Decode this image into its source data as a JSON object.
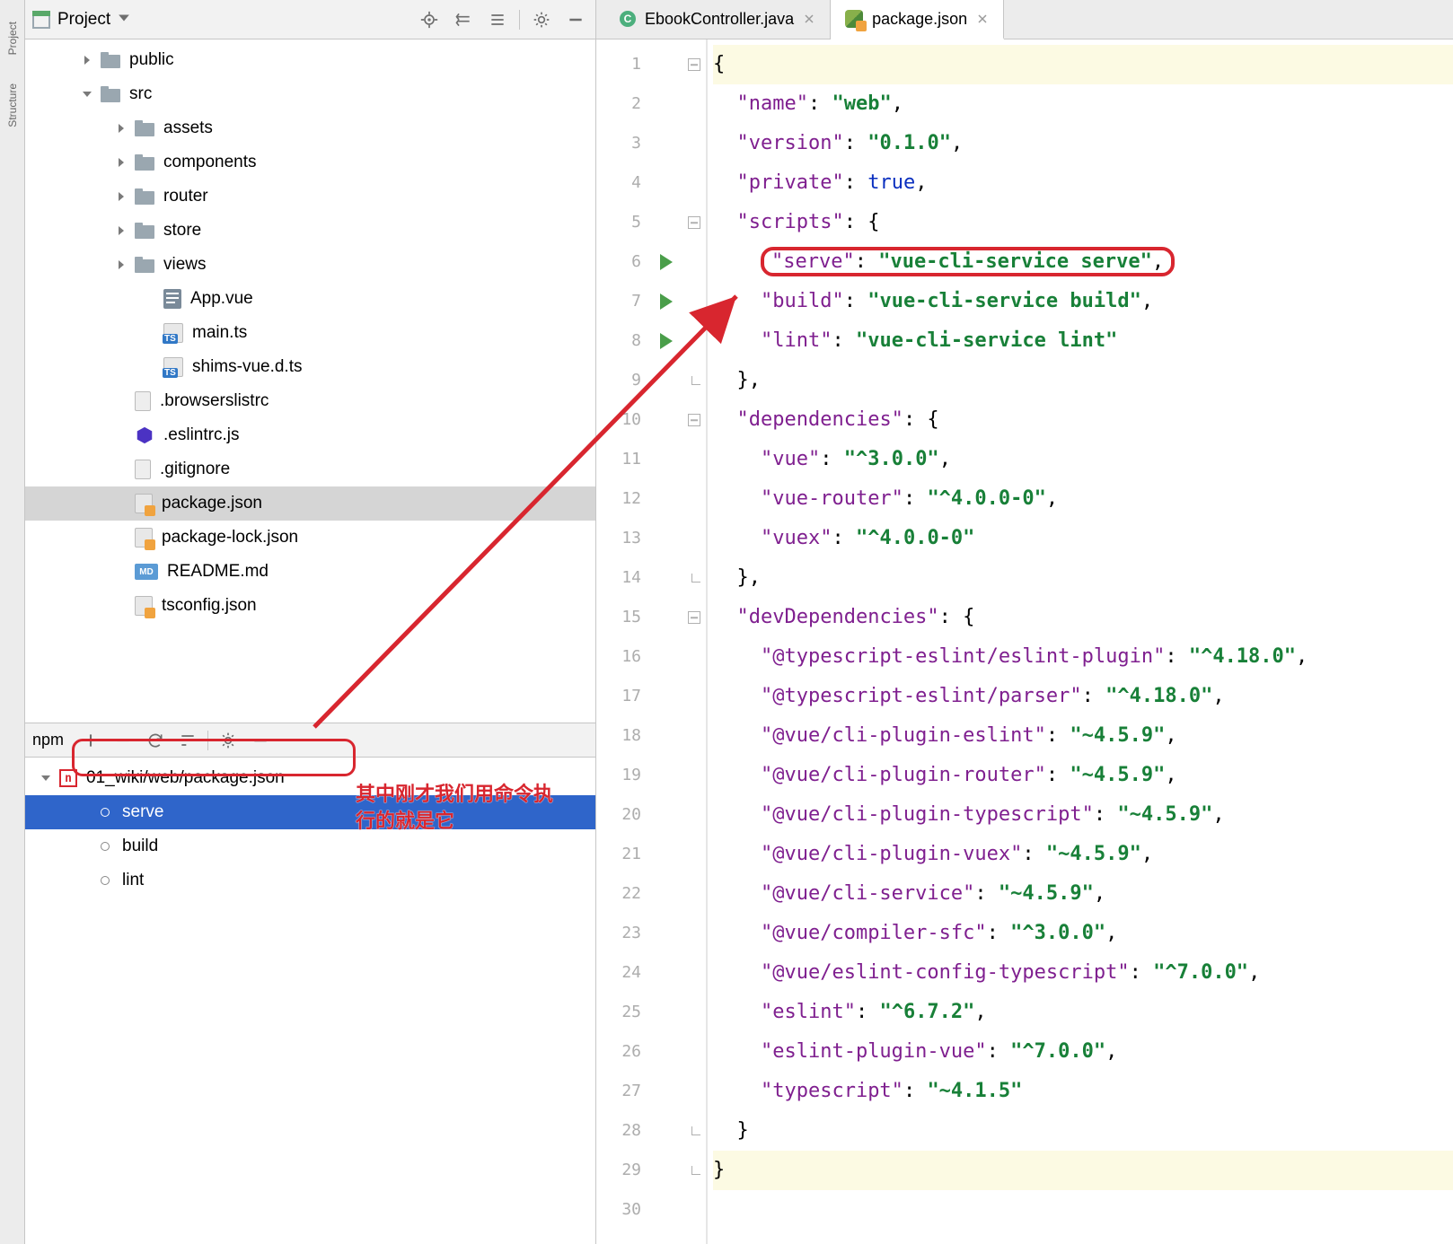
{
  "left_tabs": {
    "project": "Project",
    "structure": "Structure"
  },
  "project_header": {
    "title": "Project"
  },
  "tree": [
    {
      "indent": 60,
      "twisty": "right",
      "icon": "folder",
      "label": "public"
    },
    {
      "indent": 60,
      "twisty": "down",
      "icon": "folder",
      "label": "src"
    },
    {
      "indent": 98,
      "twisty": "right",
      "icon": "folder",
      "label": "assets"
    },
    {
      "indent": 98,
      "twisty": "right",
      "icon": "folder",
      "label": "components"
    },
    {
      "indent": 98,
      "twisty": "right",
      "icon": "folder",
      "label": "router"
    },
    {
      "indent": 98,
      "twisty": "right",
      "icon": "folder",
      "label": "store"
    },
    {
      "indent": 98,
      "twisty": "right",
      "icon": "folder",
      "label": "views"
    },
    {
      "indent": 130,
      "twisty": "none",
      "icon": "vue",
      "label": "App.vue"
    },
    {
      "indent": 130,
      "twisty": "none",
      "icon": "ts",
      "label": "main.ts"
    },
    {
      "indent": 130,
      "twisty": "none",
      "icon": "ts",
      "label": "shims-vue.d.ts"
    },
    {
      "indent": 98,
      "twisty": "none",
      "icon": "file",
      "label": ".browserslistrc"
    },
    {
      "indent": 98,
      "twisty": "none",
      "icon": "eslint",
      "label": ".eslintrc.js"
    },
    {
      "indent": 98,
      "twisty": "none",
      "icon": "file",
      "label": ".gitignore"
    },
    {
      "indent": 98,
      "twisty": "none",
      "icon": "npm",
      "label": "package.json",
      "selected": true
    },
    {
      "indent": 98,
      "twisty": "none",
      "icon": "npm",
      "label": "package-lock.json"
    },
    {
      "indent": 98,
      "twisty": "none",
      "icon": "md",
      "label": "README.md"
    },
    {
      "indent": 98,
      "twisty": "none",
      "icon": "npm",
      "label": "tsconfig.json"
    }
  ],
  "npm": {
    "title": "npm",
    "root": "01_wiki/web/package.json",
    "scripts": [
      {
        "name": "serve",
        "selected": true
      },
      {
        "name": "build"
      },
      {
        "name": "lint"
      }
    ],
    "note_line1": "其中刚才我们用命令执",
    "note_line2": "行的就是它"
  },
  "tabs": [
    {
      "icon": "c",
      "label": "EbookController.java",
      "active": false
    },
    {
      "icon": "n",
      "label": "package.json",
      "active": true
    }
  ],
  "editor": {
    "lines": [
      {
        "n": 1,
        "fold": "open",
        "hl": true,
        "html": "{"
      },
      {
        "n": 2,
        "html": "  <span class='p'>\"name\"</span>: <span class='s'>\"web\"</span>,"
      },
      {
        "n": 3,
        "html": "  <span class='p'>\"version\"</span>: <span class='s'>\"0.1.0\"</span>,"
      },
      {
        "n": 4,
        "html": "  <span class='p'>\"private\"</span>: <span class='k'>true</span>,"
      },
      {
        "n": 5,
        "fold": "open",
        "html": "  <span class='p'>\"scripts\"</span>: {"
      },
      {
        "n": 6,
        "run": true,
        "html": "    <span class='red-box'><span class='p'>\"serve\"</span>: <span class='s'>\"vue-cli-service serve\"</span>,</span>"
      },
      {
        "n": 7,
        "run": true,
        "html": "    <span class='p'>\"build\"</span>: <span class='s'>\"vue-cli-service build\"</span>,"
      },
      {
        "n": 8,
        "run": true,
        "html": "    <span class='p'>\"lint\"</span>: <span class='s'>\"vue-cli-service lint\"</span>"
      },
      {
        "n": 9,
        "fold": "end",
        "html": "  },"
      },
      {
        "n": 10,
        "fold": "open",
        "html": "  <span class='p'>\"dependencies\"</span>: {"
      },
      {
        "n": 11,
        "html": "    <span class='p'>\"vue\"</span>: <span class='s'>\"^3.0.0\"</span>,"
      },
      {
        "n": 12,
        "html": "    <span class='p'>\"vue-router\"</span>: <span class='s'>\"^4.0.0-0\"</span>,"
      },
      {
        "n": 13,
        "html": "    <span class='p'>\"vuex\"</span>: <span class='s'>\"^4.0.0-0\"</span>"
      },
      {
        "n": 14,
        "fold": "end",
        "html": "  },"
      },
      {
        "n": 15,
        "fold": "open",
        "html": "  <span class='p'>\"devDependencies\"</span>: {"
      },
      {
        "n": 16,
        "html": "    <span class='p'>\"@typescript-eslint/eslint-plugin\"</span>: <span class='s'>\"^4.18.0\"</span>,"
      },
      {
        "n": 17,
        "html": "    <span class='p'>\"@typescript-eslint/parser\"</span>: <span class='s'>\"^4.18.0\"</span>,"
      },
      {
        "n": 18,
        "html": "    <span class='p'>\"@vue/cli-plugin-eslint\"</span>: <span class='s'>\"~4.5.9\"</span>,"
      },
      {
        "n": 19,
        "html": "    <span class='p'>\"@vue/cli-plugin-router\"</span>: <span class='s'>\"~4.5.9\"</span>,"
      },
      {
        "n": 20,
        "html": "    <span class='p'>\"@vue/cli-plugin-typescript\"</span>: <span class='s'>\"~4.5.9\"</span>,"
      },
      {
        "n": 21,
        "html": "    <span class='p'>\"@vue/cli-plugin-vuex\"</span>: <span class='s'>\"~4.5.9\"</span>,"
      },
      {
        "n": 22,
        "html": "    <span class='p'>\"@vue/cli-service\"</span>: <span class='s'>\"~4.5.9\"</span>,"
      },
      {
        "n": 23,
        "html": "    <span class='p'>\"@vue/compiler-sfc\"</span>: <span class='s'>\"^3.0.0\"</span>,"
      },
      {
        "n": 24,
        "html": "    <span class='p'>\"@vue/eslint-config-typescript\"</span>: <span class='s'>\"^7.0.0\"</span>,"
      },
      {
        "n": 25,
        "html": "    <span class='p'>\"eslint\"</span>: <span class='s'>\"^6.7.2\"</span>,"
      },
      {
        "n": 26,
        "html": "    <span class='p'>\"eslint-plugin-vue\"</span>: <span class='s'>\"^7.0.0\"</span>,"
      },
      {
        "n": 27,
        "html": "    <span class='p'>\"typescript\"</span>: <span class='s'>\"~4.1.5\"</span>"
      },
      {
        "n": 28,
        "fold": "end",
        "html": "  }"
      },
      {
        "n": 29,
        "fold": "end",
        "hl": true,
        "html": "}"
      },
      {
        "n": 30,
        "html": ""
      }
    ]
  }
}
